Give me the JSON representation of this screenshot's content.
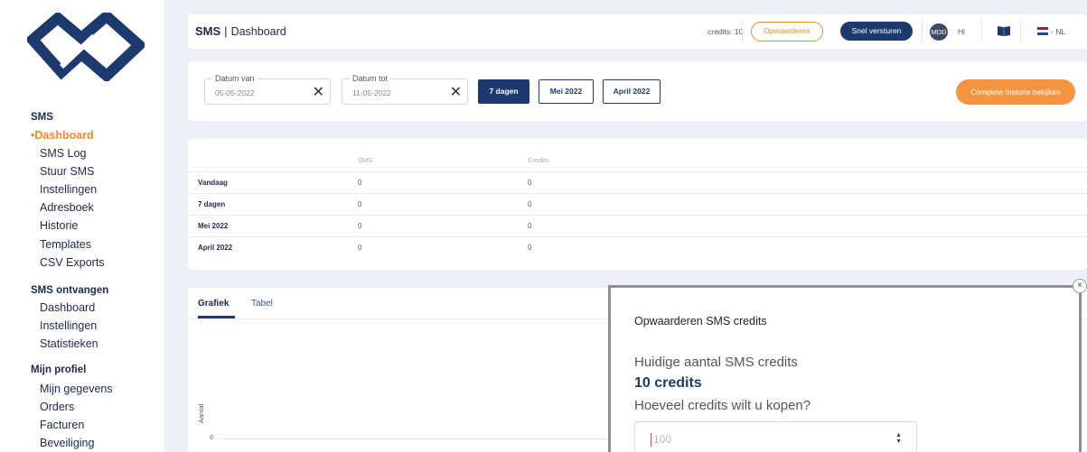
{
  "sidebar": {
    "sections": [
      {
        "title": "SMS",
        "items": [
          "Dashboard",
          "SMS Log",
          "Stuur SMS",
          "Instellingen",
          "Adresboek",
          "Historie",
          "Templates",
          "CSV Exports"
        ]
      },
      {
        "title": "SMS ontvangen",
        "items": [
          "Dashboard",
          "Instellingen",
          "Statistieken"
        ]
      },
      {
        "title": "Mijn profiel",
        "items": [
          "Mijn gegevens",
          "Orders",
          "Facturen",
          "Beveiliging"
        ]
      }
    ],
    "active_item": "Dashboard"
  },
  "header": {
    "title": "SMS",
    "subtitle": "Dashboard",
    "credits_text": "credits: 10",
    "topup_label": "Opwaarderen",
    "quick_send_label": "Snel versturen",
    "avatar_initials": "MDD",
    "greeting": "Hi",
    "language": "- NL"
  },
  "filters": {
    "date_from_label": "Datum van",
    "date_from_value": "05-05-2022",
    "date_to_label": "Datum tot",
    "date_to_value": "11-05-2022",
    "periods": [
      "7 dagen",
      "Mei 2022",
      "April 2022"
    ],
    "active_period": "7 dagen",
    "history_button": "Complete historie bekijken"
  },
  "stats_table": {
    "columns": [
      "",
      "SMS",
      "Credits"
    ],
    "rows": [
      {
        "label": "Vandaag",
        "sms": "0",
        "credits": "0"
      },
      {
        "label": "7 dagen",
        "sms": "0",
        "credits": "0"
      },
      {
        "label": "Mei 2022",
        "sms": "0",
        "credits": "0"
      },
      {
        "label": "April 2022",
        "sms": "0",
        "credits": "0"
      }
    ]
  },
  "chart_panel": {
    "tabs": [
      "Grafiek",
      "Tabel"
    ],
    "active_tab": "Grafiek",
    "y_axis_label": "Aantal",
    "y_tick": "0"
  },
  "modal": {
    "title": "Opwaarderen SMS credits",
    "current_label": "Huidige aantal SMS credits",
    "current_value": "10 credits",
    "question": "Hoeveel credits wilt u kopen?",
    "input_placeholder": "100",
    "close_symbol": "×"
  },
  "colors": {
    "navy": "#1c3a6e",
    "orange": "#f18b2c",
    "background": "#eef0f8"
  }
}
